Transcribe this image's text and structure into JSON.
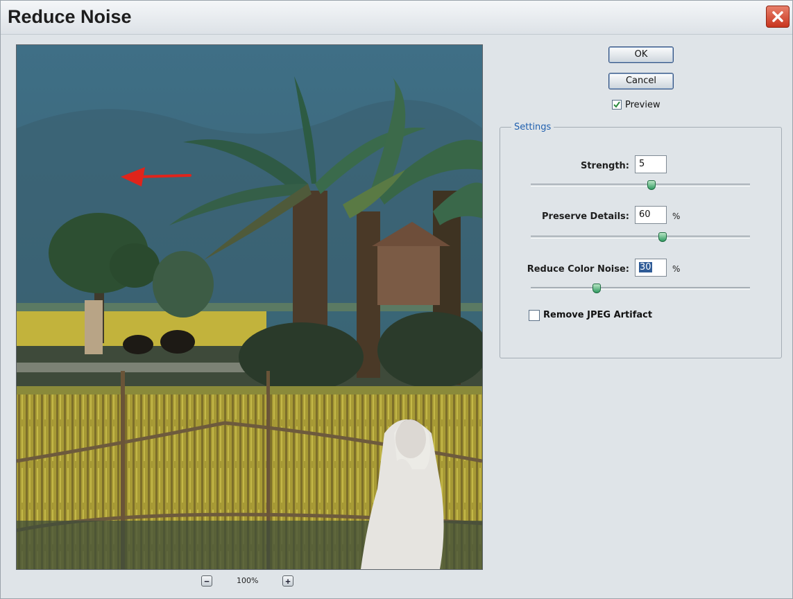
{
  "window": {
    "title": "Reduce Noise",
    "close_icon": "close-icon"
  },
  "buttons": {
    "ok_label": "OK",
    "cancel_label": "Cancel"
  },
  "preview": {
    "label": "Preview",
    "checked": true
  },
  "settings": {
    "group_title": "Settings",
    "strength": {
      "label": "Strength:",
      "value": "5",
      "slider_fraction": 0.55
    },
    "preserve_details": {
      "label": "Preserve Details:",
      "value": "60",
      "unit": "%",
      "slider_fraction": 0.6
    },
    "reduce_color_noise": {
      "label": "Reduce Color Noise:",
      "value": "30",
      "unit": "%",
      "slider_fraction": 0.3
    },
    "remove_jpeg": {
      "label": "Remove JPEG Artifact",
      "checked": false
    }
  },
  "zoom": {
    "level": "100%",
    "zoom_out_icon": "minus-icon",
    "zoom_in_icon": "plus-icon"
  },
  "colors": {
    "dialog_bg": "#dfe4e8",
    "group_title": "#1f5fae",
    "close_red": "#c8351f",
    "slider_thumb": "#2f9a61",
    "annotation_arrow": "#e0241b"
  }
}
